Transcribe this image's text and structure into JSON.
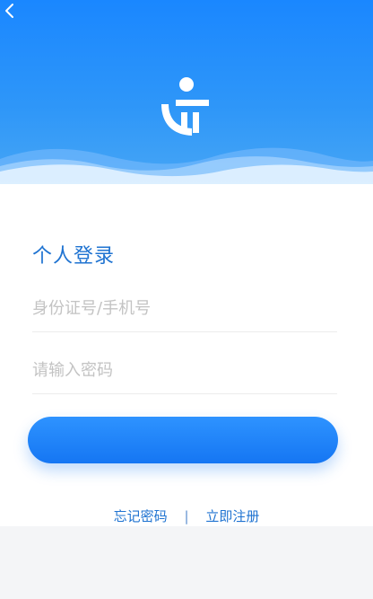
{
  "screen": {
    "title": "个人登录",
    "id_input_placeholder": "身份证号/手机号",
    "password_input_placeholder": "请输入密码",
    "login_button_label": "",
    "forgot_password_label": "忘记密码",
    "separator": "|",
    "register_label": "立即注册"
  },
  "icons": {
    "back": "chevron-left-icon",
    "logo": "brand-logo-icon"
  },
  "colors": {
    "primary": "#1576f3",
    "title": "#1f73d1",
    "header_top": "#1a87ff",
    "header_bottom": "#47a6f5",
    "placeholder": "#c3c3c3",
    "background": "#f4f5f7"
  }
}
